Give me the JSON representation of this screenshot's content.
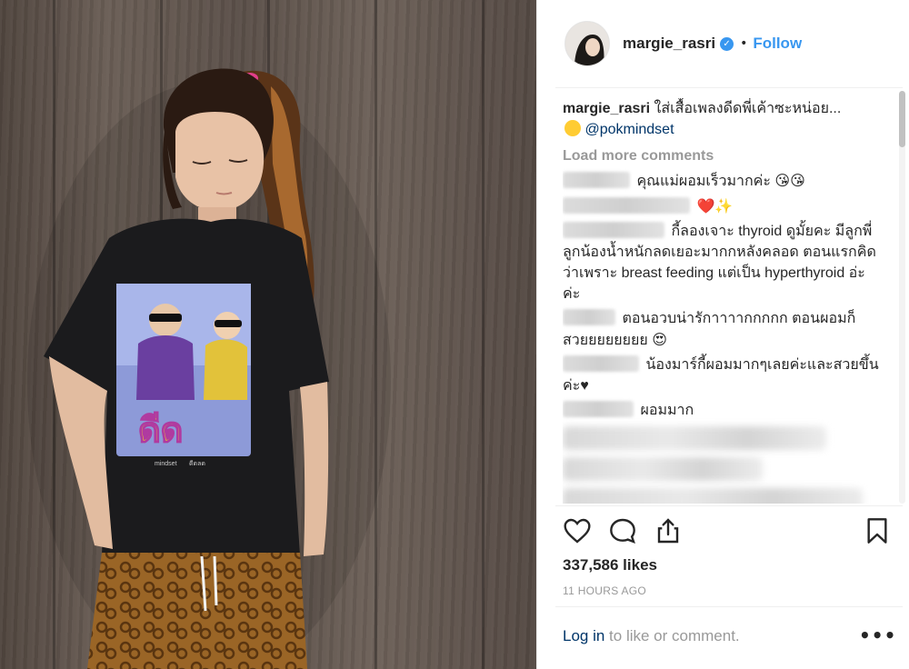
{
  "post": {
    "username": "margie_rasri",
    "follow_label": "Follow",
    "dot": "•",
    "caption_text": "ใส่เสื้อเพลงดีดพี่เค้าซะหน่อย...",
    "caption_mention": "@pokmindset",
    "load_more": "Load more comments",
    "likes": "337,586 likes",
    "time_ago": "11 HOURS AGO",
    "login_link": "Log in",
    "login_rest": " to like or comment.",
    "more_label": "•••"
  },
  "comments": [
    {
      "text": "คุณแม่ผอมเร็วมากค่ะ",
      "emoji": "😘😘"
    },
    {
      "text": "",
      "emoji": "❤️✨"
    },
    {
      "text": "กี้ลองเจาะ thyroid ดูมั้ยคะ มีลูกพี่ลูกน้องน้ำหนักลดเยอะมากกหลังคลอด ตอนแรกคิดว่าเพราะ breast feeding แต่เป็น hyperthyroid อ่ะค่ะ",
      "emoji": ""
    },
    {
      "text": "ตอนอวบน่ารักาาาากกกกก ตอนผอมก็สวยยยยยยยย",
      "emoji": "😍"
    },
    {
      "text": "น้องมาร์กี้ผอมมากๆเลยค่ะและสวยขึ้นค่ะ♥",
      "emoji": ""
    },
    {
      "text": "ผอมมาก",
      "emoji": ""
    }
  ],
  "photo": {
    "shirt_text": "ดีด",
    "shirt_small_left": "mindset",
    "shirt_small_mid": "ดีดลด"
  },
  "colors": {
    "accent": "#3897f0",
    "text": "#262626",
    "muted": "#999999",
    "link": "#003569"
  },
  "icons": [
    "verified-badge-icon",
    "heart-icon",
    "comment-icon",
    "share-icon",
    "bookmark-icon",
    "more-options-icon"
  ]
}
